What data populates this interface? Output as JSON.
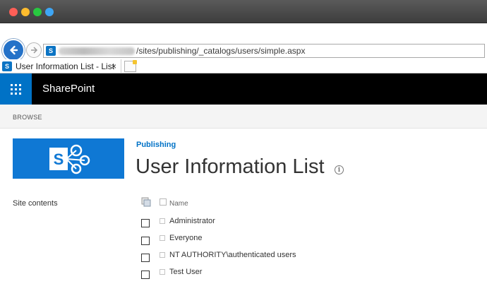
{
  "browser": {
    "url_path": "/sites/publishing/_catalogs/users/simple.aspx",
    "tab_title": "User Information List - List V...",
    "tab_close": "×",
    "site_icon_glyph": "S"
  },
  "suite_bar": {
    "brand": "SharePoint",
    "accent_color": "#0072c6"
  },
  "ribbon": {
    "tab_label": "BROWSE"
  },
  "header": {
    "breadcrumb": "Publishing",
    "title": "User Information List",
    "info_glyph": "i",
    "logo_glyph": "S"
  },
  "left_nav": {
    "items": [
      {
        "label": "Site contents"
      }
    ]
  },
  "list": {
    "column_header": "Name",
    "rows": [
      {
        "name": "Administrator"
      },
      {
        "name": "Everyone"
      },
      {
        "name": "NT AUTHORITY\\authenticated users"
      },
      {
        "name": "Test User"
      }
    ]
  }
}
